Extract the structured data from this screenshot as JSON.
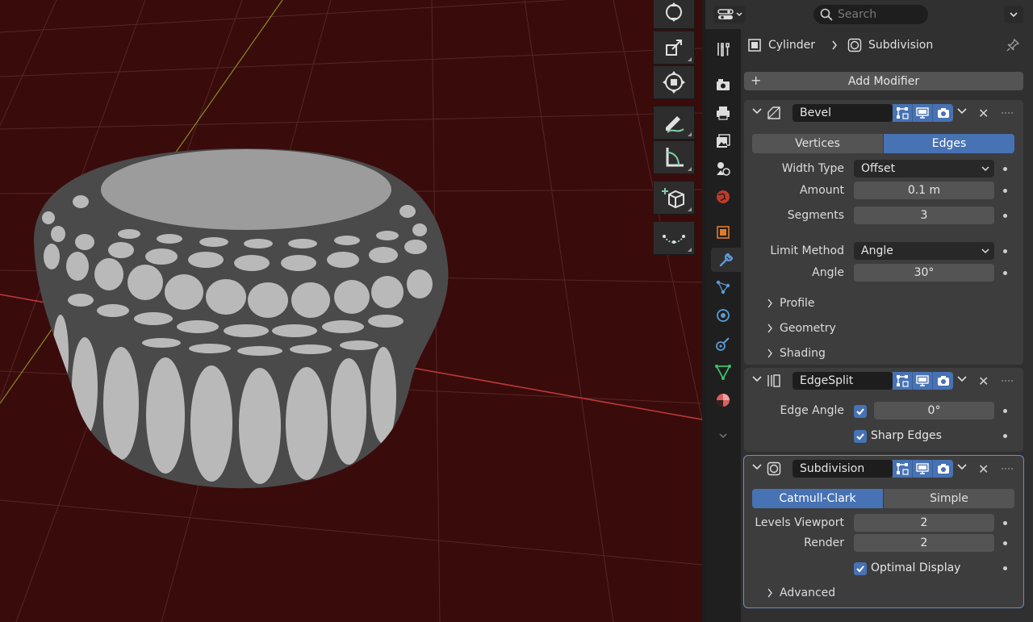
{
  "header": {
    "search_placeholder": "Search"
  },
  "breadcrumb": {
    "object": "Cylinder",
    "modifier": "Subdivision"
  },
  "add_modifier_label": "Add Modifier",
  "colors": {
    "accent": "#4772b3",
    "viewport_bg": "#3a0b0b",
    "panel_bg": "#303030",
    "box_bg": "#3d3d3d"
  },
  "modifiers": {
    "bevel": {
      "name": "Bevel",
      "affect": [
        "Vertices",
        "Edges"
      ],
      "affect_selected": "Edges",
      "width_type_label": "Width Type",
      "width_type": "Offset",
      "amount_label": "Amount",
      "amount": "0.1 m",
      "segments_label": "Segments",
      "segments": "3",
      "limit_method_label": "Limit Method",
      "limit_method": "Angle",
      "angle_label": "Angle",
      "angle": "30°",
      "subpanels": [
        "Profile",
        "Geometry",
        "Shading"
      ]
    },
    "edgesplit": {
      "name": "EdgeSplit",
      "edge_angle_label": "Edge Angle",
      "edge_angle": "0°",
      "edge_angle_checked": true,
      "sharp_edges_label": "Sharp Edges",
      "sharp_edges_checked": true
    },
    "subdivision": {
      "name": "Subdivision",
      "types": [
        "Catmull-Clark",
        "Simple"
      ],
      "type_selected": "Catmull-Clark",
      "levels_viewport_label": "Levels Viewport",
      "levels_viewport": "2",
      "render_label": "Render",
      "render": "2",
      "optimal_display_label": "Optimal Display",
      "optimal_display_checked": true,
      "subpanels": [
        "Advanced"
      ]
    }
  }
}
